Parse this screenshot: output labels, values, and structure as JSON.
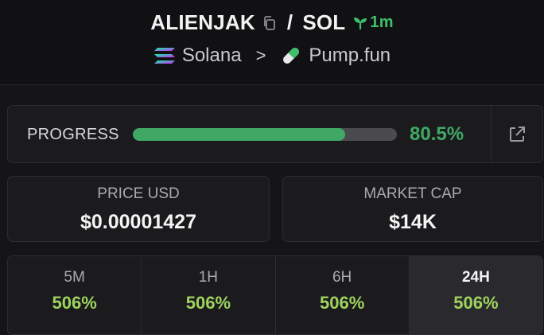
{
  "header": {
    "token": "ALIENJAK",
    "separator": "/",
    "quote": "SOL",
    "age": "1m",
    "chain": "Solana",
    "platform": "Pump.fun"
  },
  "progress": {
    "label": "PROGRESS",
    "value_text": "80.5%",
    "fraction": 0.805
  },
  "stats": {
    "price_label": "PRICE USD",
    "price_value": "$0.00001427",
    "mcap_label": "MARKET CAP",
    "mcap_value": "$14K"
  },
  "timeframes": [
    {
      "label": "5M",
      "value": "506%"
    },
    {
      "label": "1H",
      "value": "506%"
    },
    {
      "label": "6H",
      "value": "506%"
    },
    {
      "label": "24H",
      "value": "506%"
    }
  ],
  "active_timeframe": "24H",
  "colors": {
    "accent_green": "#3fa864",
    "change_green": "#9fd35e",
    "background": "#151517"
  },
  "icons": [
    "copy-icon",
    "sprout-icon",
    "solana-logo",
    "chevron-right-icon",
    "pill-icon",
    "external-link-icon"
  ]
}
